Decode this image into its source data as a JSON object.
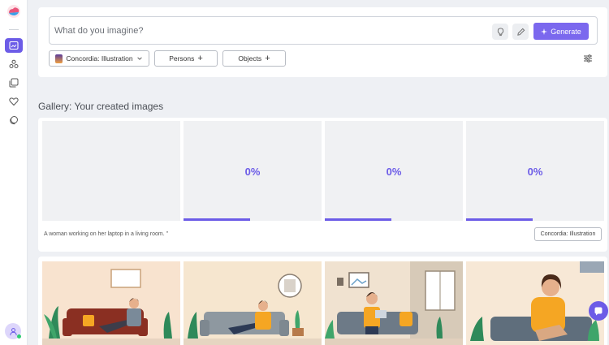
{
  "prompt": {
    "placeholder": "What do you imagine?",
    "generate_label": "Generate"
  },
  "filters": {
    "model_label": "Concordia: Illustration",
    "persons_label": "Persons",
    "objects_label": "Objects",
    "plus": "+"
  },
  "gallery": {
    "title": "Gallery: Your created images",
    "tiles": [
      {
        "percent": ""
      },
      {
        "percent": "0%",
        "progress": 0.48
      },
      {
        "percent": "0%",
        "progress": 0.48
      },
      {
        "percent": "0%",
        "progress": 0.48
      }
    ],
    "caption": "A woman working on her laptop in a living room. \"",
    "style_badge": "Concordia: Illustration"
  },
  "colors": {
    "accent": "#6c5ce7",
    "generate_bg": "#7b68ee"
  },
  "icons": {
    "logo": "cloud-logo-icon",
    "sidebar": [
      "image-generate-icon",
      "persons-icon",
      "gallery-icon",
      "heart-icon",
      "collections-icon"
    ],
    "prompt": [
      "lightbulb-icon",
      "pencil-icon",
      "sparkle-icon"
    ],
    "filter": "sliders-icon",
    "chat": "chat-icon"
  }
}
